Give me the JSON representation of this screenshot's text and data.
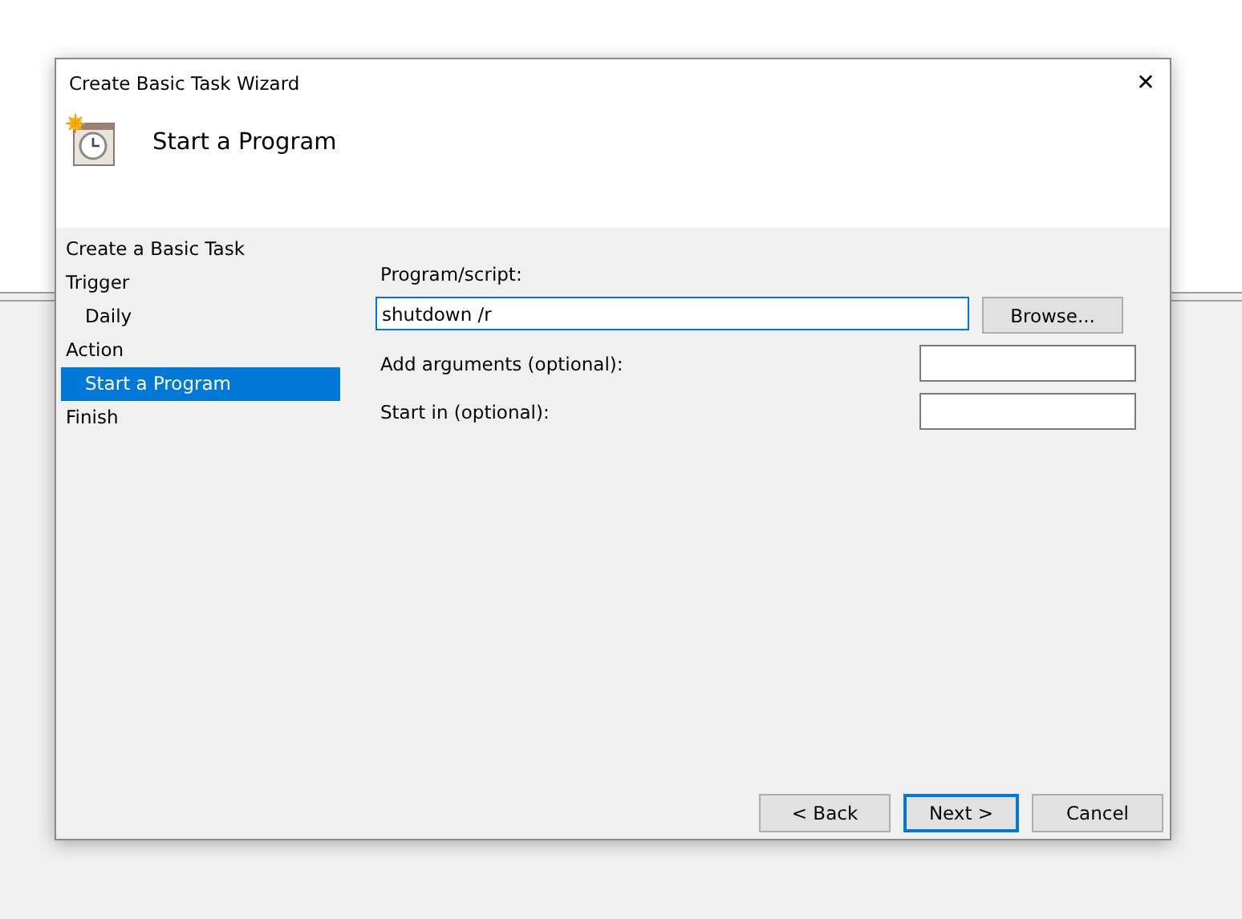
{
  "window": {
    "title": "Create Basic Task Wizard",
    "close": "✕"
  },
  "header": {
    "title": "Start a Program"
  },
  "steps": [
    {
      "label": "Create a Basic Task",
      "selected": false
    },
    {
      "label": "Trigger",
      "selected": false,
      "children": [
        {
          "label": "Daily",
          "selected": false
        }
      ]
    },
    {
      "label": "Action",
      "selected": false,
      "children": [
        {
          "label": "Start a Program",
          "selected": true
        }
      ]
    },
    {
      "label": "Finish",
      "selected": false
    }
  ],
  "program": {
    "label": "Program/script:",
    "value": "shutdown /r",
    "browse": "Browse..."
  },
  "fields": [
    {
      "label": "Add arguments (optional):"
    },
    {
      "label": "Start in (optional):"
    }
  ],
  "buttons": [
    {
      "label": "< Back",
      "default": false
    },
    {
      "label": "Next >",
      "default": true
    },
    {
      "label": "Cancel",
      "default": false
    }
  ]
}
